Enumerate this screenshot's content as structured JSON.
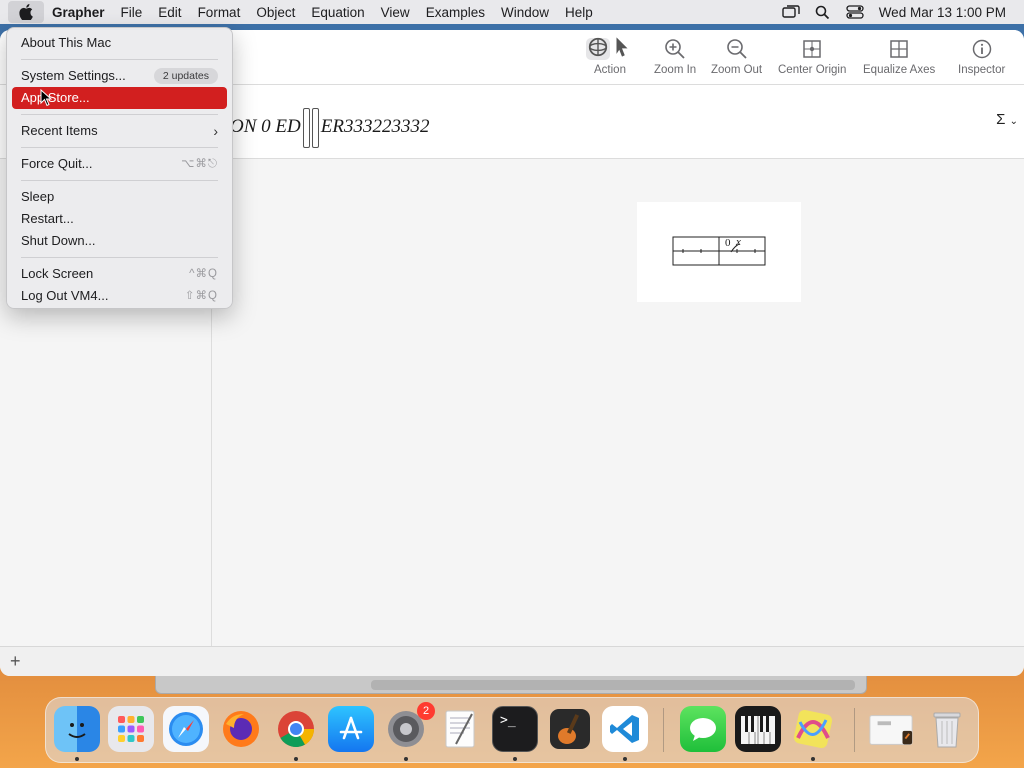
{
  "menubar": {
    "app_name": "Grapher",
    "items": [
      "File",
      "Edit",
      "Format",
      "Object",
      "Equation",
      "View",
      "Examples",
      "Window",
      "Help"
    ],
    "clock": "Wed Mar 13  1:00 PM",
    "status_icons": [
      "screen-mirroring-icon",
      "spotlight-search-icon",
      "control-center-icon"
    ]
  },
  "apple_menu": {
    "items": [
      {
        "label": "About This Mac"
      },
      {
        "label": "System Settings...",
        "badge": "2 updates"
      },
      {
        "label": "App Store...",
        "selected": true
      },
      {
        "label": "Recent Items",
        "submenu": true
      },
      {
        "label": "Force Quit...",
        "shortcut": "⌥⌘⎋"
      },
      {
        "label": "Sleep"
      },
      {
        "label": "Restart..."
      },
      {
        "label": "Shut Down..."
      },
      {
        "label": "Lock Screen",
        "shortcut": "^⌘Q"
      },
      {
        "label": "Log Out VM4...",
        "shortcut": "⇧⌘Q"
      }
    ]
  },
  "toolbar": {
    "action": "Action",
    "zoom_in": "Zoom In",
    "zoom_out": "Zoom Out",
    "center_origin": "Center Origin",
    "equalize_axes": "Equalize Axes",
    "inspector": "Inspector"
  },
  "equation": {
    "prefix": "ON 0 ED",
    "suffix": "ER333223332",
    "sigma": "Σ"
  },
  "graph": {
    "origin_label": "0",
    "axis_label": "x"
  },
  "dock": {
    "apps": [
      "Finder",
      "Launchpad",
      "Safari",
      "Firefox",
      "Chrome",
      "App Store",
      "System Settings",
      "TextEdit",
      "Terminal",
      "GarageBand",
      "Visual Studio Code",
      "Messages",
      "Piano",
      "Grapher",
      "Downloads",
      "Trash"
    ],
    "settings_badge": "2"
  },
  "colors": {
    "selection": "#d21f1f",
    "menubar_bg": "#e9e9ec",
    "window_bg": "#f5f5f5"
  }
}
